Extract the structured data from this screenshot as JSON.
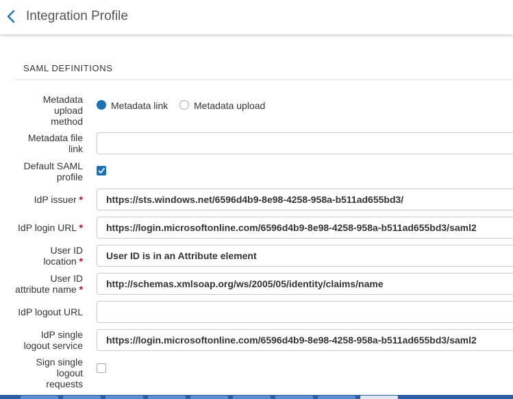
{
  "header": {
    "title": "Integration Profile",
    "back_icon": "chevron-left-icon"
  },
  "section": {
    "title": "SAML DEFINITIONS"
  },
  "form": {
    "metadata_upload_method": {
      "label_lines": [
        "Metadata",
        "upload",
        "method"
      ],
      "options": [
        "Metadata link",
        "Metadata upload"
      ],
      "selected": "Metadata link"
    },
    "metadata_file_link": {
      "label_lines": [
        "Metadata file",
        "link"
      ],
      "value": ""
    },
    "default_saml_profile": {
      "label_lines": [
        "Default SAML",
        "profile"
      ],
      "checked": true
    },
    "idp_issuer": {
      "label": "IdP issuer",
      "required_mark": "*",
      "value": "https://sts.windows.net/6596d4b9-8e98-4258-958a-b511ad655bd3/"
    },
    "idp_login_url": {
      "label": "IdP login URL",
      "required_mark": "*",
      "value": "https://login.microsoftonline.com/6596d4b9-8e98-4258-958a-b511ad655bd3/saml2"
    },
    "user_id_location": {
      "label_lines": [
        "User ID",
        "location"
      ],
      "required_mark": "*",
      "value": "User ID is in an Attribute element"
    },
    "user_id_attribute_name": {
      "label_lines": [
        "User ID",
        "attribute name"
      ],
      "required_mark": "*",
      "value": "http://schemas.xmlsoap.org/ws/2005/05/identity/claims/name"
    },
    "idp_logout_url": {
      "label": "IdP logout URL",
      "value": ""
    },
    "idp_single_logout_service": {
      "label_lines": [
        "IdP single",
        "logout service"
      ],
      "value": "https://login.microsoftonline.com/6596d4b9-8e98-4258-958a-b511ad655bd3/saml2"
    },
    "sign_single_logout_requests": {
      "label_lines": [
        "Sign single",
        "logout",
        "requests"
      ],
      "checked": false
    }
  },
  "colors": {
    "accent": "#1a73b8",
    "required": "#d0021b",
    "border": "#c9c9c9"
  }
}
